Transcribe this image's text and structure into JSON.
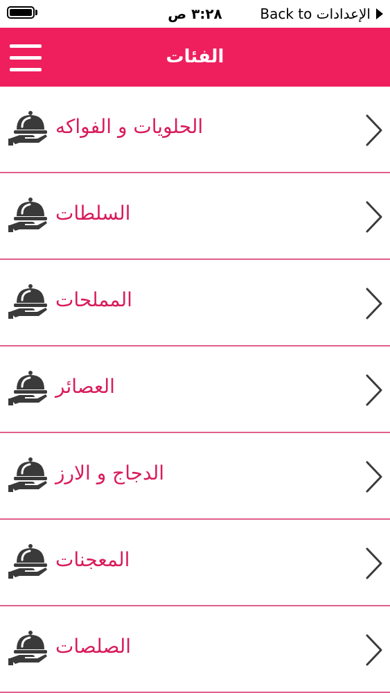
{
  "status_bar": {
    "time": "٣:٢٨ ص",
    "back_label": "Back to الإعدادات"
  },
  "nav": {
    "title": "الفئات",
    "menu_icon": "hamburger-menu-icon"
  },
  "categories": [
    {
      "label": "الحلويات و الفواكه",
      "icon": "serving-cloche-icon"
    },
    {
      "label": "السلطات",
      "icon": "serving-cloche-icon"
    },
    {
      "label": "المملحات",
      "icon": "serving-cloche-icon"
    },
    {
      "label": "العصائر",
      "icon": "serving-cloche-icon"
    },
    {
      "label": "الدجاج و الارز",
      "icon": "serving-cloche-icon"
    },
    {
      "label": "المعجنات",
      "icon": "serving-cloche-icon"
    },
    {
      "label": "الصلصات",
      "icon": "serving-cloche-icon"
    }
  ],
  "colors": {
    "accent": "#ef1f5e",
    "label_text": "#d81b5c",
    "divider": "#e05f8c",
    "icon": "#3a3a3a"
  }
}
